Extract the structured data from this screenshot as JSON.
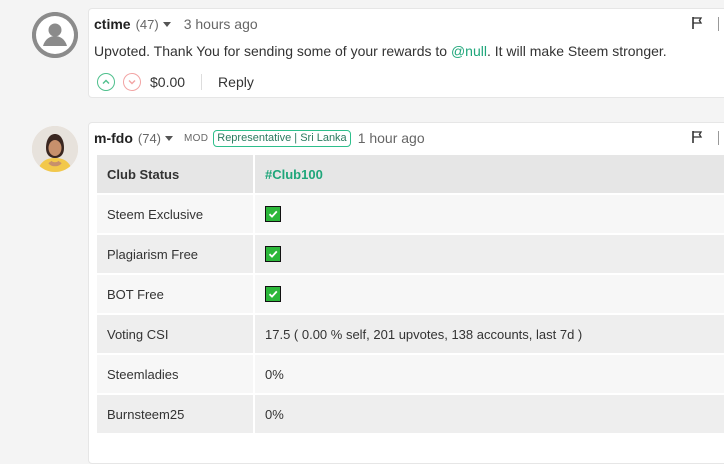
{
  "comment1": {
    "author": "ctime",
    "reputation": "(47)",
    "time": "3 hours ago",
    "body_prefix": "Upvoted. Thank You for sending some of your rewards to ",
    "mention": "@null",
    "body_suffix": ". It will make Steem stronger.",
    "payout": "$0.00",
    "reply_label": "Reply"
  },
  "comment2": {
    "author": "m-fdo",
    "reputation": "(74)",
    "mod_label": "MOD",
    "badge": "Representative | Sri Lanka",
    "time": "1 hour ago",
    "table": {
      "header": {
        "key": "Club Status",
        "value": "#Club100"
      },
      "rows": [
        {
          "key": "Steem Exclusive",
          "check": true
        },
        {
          "key": "Plagiarism Free",
          "check": true
        },
        {
          "key": "BOT Free",
          "check": true
        },
        {
          "key": "Voting CSI",
          "value": "17.5 ( 0.00 % self, 201 upvotes, 138 accounts, last 7d )"
        },
        {
          "key": "Steemladies",
          "value": "0%"
        },
        {
          "key": "Burnsteem25",
          "value": "0%"
        }
      ]
    }
  },
  "icons": {
    "avatar_default": "user-avatar-icon",
    "flag": "flag-icon",
    "upvote": "chevron-up-icon",
    "downvote": "chevron-down-icon",
    "check": "checkbox-checked-icon"
  },
  "colors": {
    "link": "#1fa67a",
    "check": "#2bb73a",
    "upvote": "#4fc08d",
    "downvote": "#f2a3a3"
  }
}
